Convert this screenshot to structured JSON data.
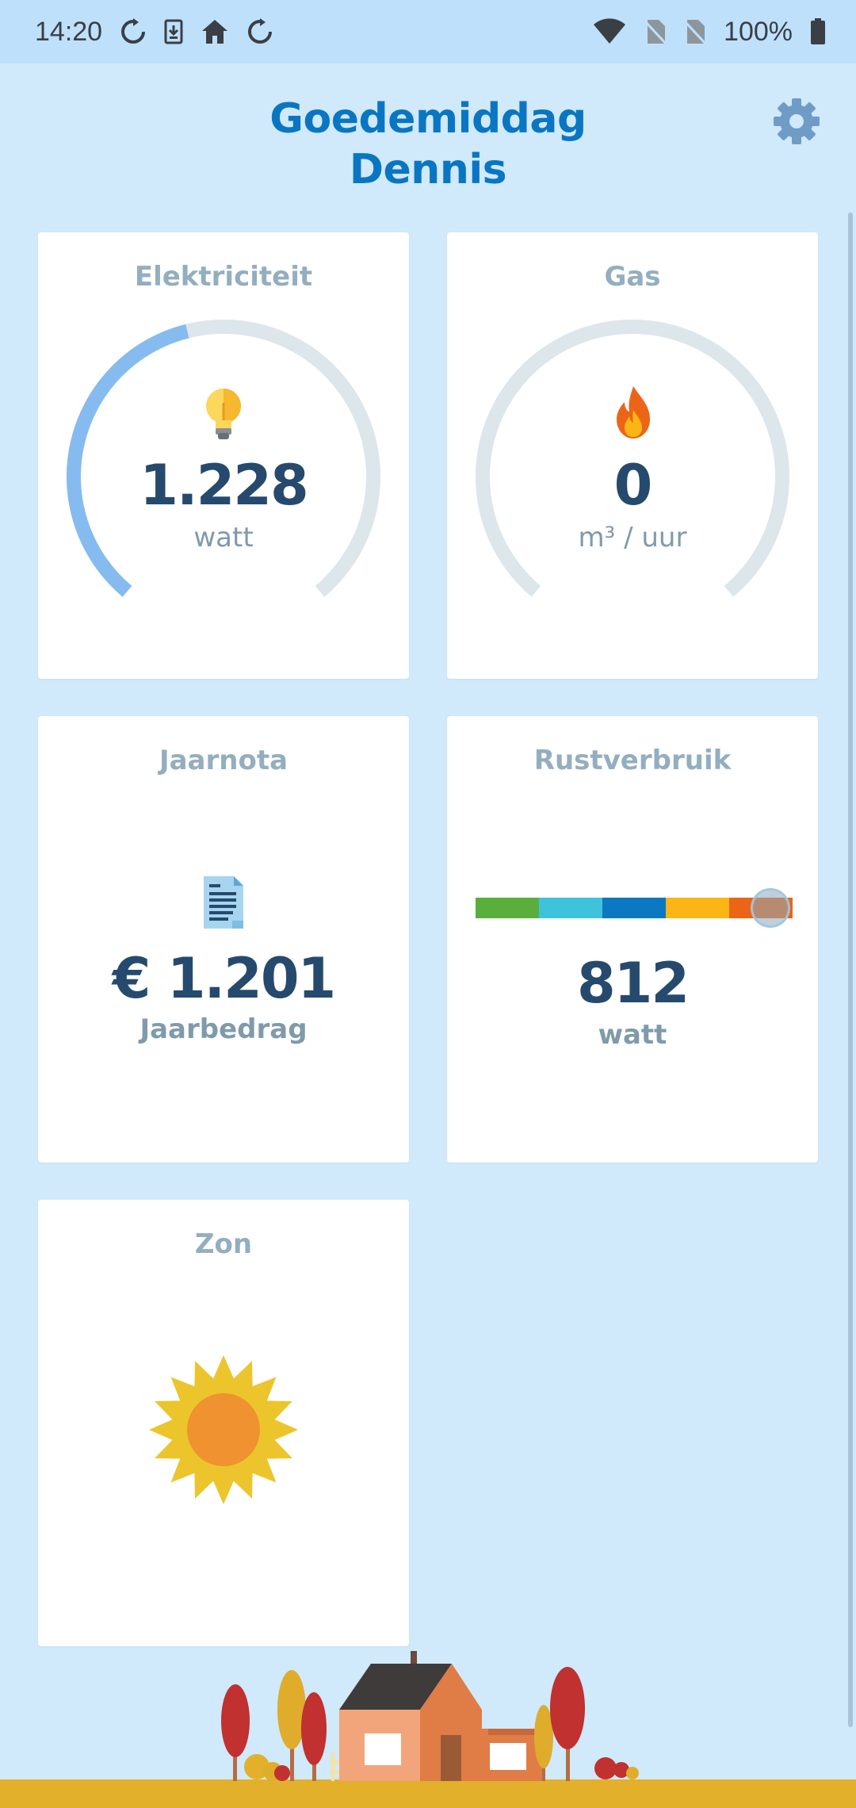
{
  "status_bar": {
    "time": "14:20",
    "battery": "100%",
    "left_icons": [
      "sync-icon",
      "download-icon",
      "home-icon",
      "sync-icon"
    ],
    "right_icons": [
      "wifi-icon",
      "no-sim-icon",
      "no-sim-icon",
      "battery-icon"
    ]
  },
  "header": {
    "greeting_line1": "Goedemiddag",
    "greeting_line2": "Dennis",
    "settings_icon": "gear-icon"
  },
  "cards": {
    "electricity": {
      "title": "Elektriciteit",
      "value": "1.228",
      "unit": "watt",
      "icon": "lightbulb-icon",
      "gauge_fraction": 0.45
    },
    "gas": {
      "title": "Gas",
      "value": "0",
      "unit": "m³ / uur",
      "icon": "flame-icon",
      "gauge_fraction": 0
    },
    "jaarnota": {
      "title": "Jaarnota",
      "value": "€ 1.201",
      "label": "Jaarbedrag",
      "icon": "document-icon"
    },
    "rustverbruik": {
      "title": "Rustverbruik",
      "value": "812",
      "unit": "watt",
      "scale_colors": [
        "#5aaf3c",
        "#3fc3dd",
        "#0b78c1",
        "#fbb615",
        "#ec6517"
      ],
      "indicator_fraction": 0.93
    },
    "zon": {
      "title": "Zon",
      "icon": "sun-icon"
    }
  },
  "colors": {
    "background": "#d0e9fb",
    "accent": "#0a76c2",
    "gauge_active": "#86bbef",
    "gauge_track": "#dce6eb",
    "value_text": "#264a6d"
  }
}
